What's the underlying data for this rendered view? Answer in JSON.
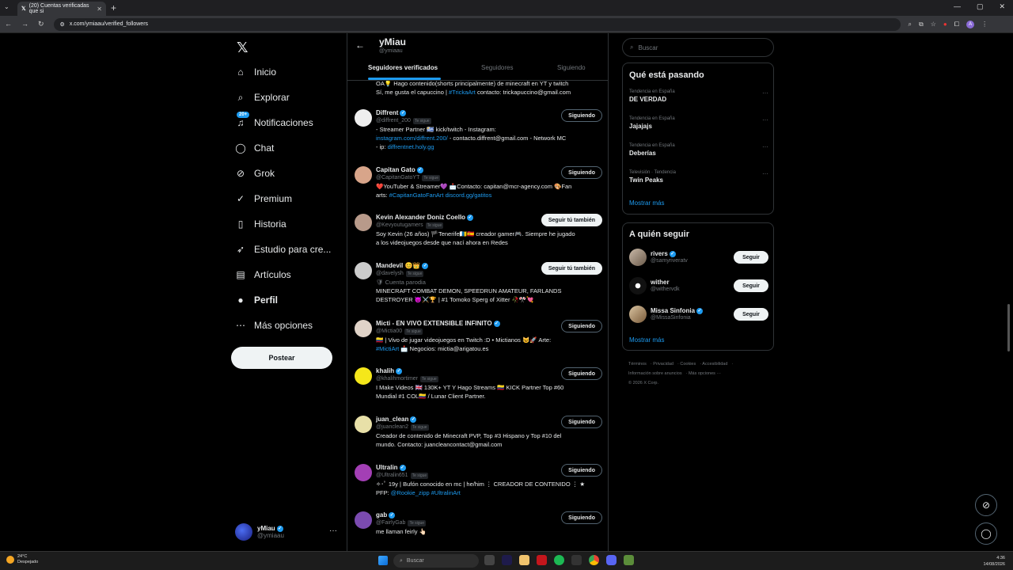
{
  "browser": {
    "tab_title": "(20) Cuentas verificadas que si",
    "url": "x.com/ymiaau/verified_followers"
  },
  "nav": {
    "items": [
      {
        "label": "Inicio",
        "icon": "home-icon"
      },
      {
        "label": "Explorar",
        "icon": "search-icon"
      },
      {
        "label": "Notificaciones",
        "icon": "bell-icon",
        "badge": "20+"
      },
      {
        "label": "Chat",
        "icon": "chat-icon"
      },
      {
        "label": "Grok",
        "icon": "grok-icon"
      },
      {
        "label": "Premium",
        "icon": "premium-icon"
      },
      {
        "label": "Historia",
        "icon": "bookmark-icon"
      },
      {
        "label": "Estudio para cre...",
        "icon": "rocket-icon"
      },
      {
        "label": "Artículos",
        "icon": "article-icon"
      },
      {
        "label": "Perfil",
        "icon": "person-icon"
      },
      {
        "label": "Más opciones",
        "icon": "more-icon"
      }
    ],
    "post_label": "Postear",
    "account": {
      "name": "yMiau",
      "handle": "@ymiaau"
    }
  },
  "profile_header": {
    "name": "yMiau",
    "handle": "@ymiaau",
    "tabs": [
      "Seguidores verificados",
      "Seguidores",
      "Siguiendo"
    ]
  },
  "followers": [
    {
      "name": "",
      "handle": "",
      "button": "",
      "bio_html": "OA💡 Hago contenido(shorts principalmente) de minecraft en YT y twitch<br>Sí, me gusta el capuccino | <span class='link'>#TrickaArt</span> contacto: trickapuccino@gmail.com"
    },
    {
      "name": "Diffrent",
      "handle": "@diffrent_200",
      "button": "Siguiendo",
      "bio_html": "- Streamer Partner 🇺🇾 kick/twitch - Instagram:<br><span class='link'>instagram.com/diffrent.200/</span> - contacto.diffrent@gmail.com - Network MC<br>- ip: <span class='link'>diffrentnet.holy.gg</span>"
    },
    {
      "name": "Capitan Gato",
      "handle": "@CapitanGatoYT",
      "button": "Siguiendo",
      "bio_html": "❤️YouTuber &amp; Streamer💜 📩Contacto: capitan@mcr-agency.com 🎨Fan<br>arts: <span class='link'>#CapitanGatoFanArt</span> <span class='link'>discord.gg/gatitos</span>"
    },
    {
      "name": "Kevin Alexander Doniz Coello",
      "handle": "@Kevyoutugamers",
      "button": "Seguir tú también",
      "bio_html": "Soy Kevin (26 años) 🏴Tenerife🇮🇨🇪🇸 creador gamer🎮. Siempre he jugado<br>a los videojuegos desde que nací ahora en Redes"
    },
    {
      "name": "Mandevil 😊👑",
      "handle": "@davelysh",
      "button": "Seguir tú también",
      "bio_html": "<span style='color:#71767b'>🛡 Cuenta parodia</span><br>MINECRAFT COMBAT DEMON, SPEEDRUN AMATEUR, FARLANDS<br>DESTROYER 😈⚔️🏆 | #1 Tomoko Sperg of Xitter 🥀🎌💘"
    },
    {
      "name": "Micti - EN VIVO EXTENSIBLE INFINITO",
      "handle": "@Mictia00",
      "button": "Siguiendo",
      "bio_html": "🇨🇴 | Vivo de jugar videojuegos en Twitch :D • Micti​anos 😺🚀 Arte:<br><span class='link'>#MictiArt</span> 📩 Negocios: mictia@arigatou.es"
    },
    {
      "name": "khalih",
      "handle": "@khalihmortimer",
      "button": "Siguiendo",
      "bio_html": "I Make Videos 🇬🇧 130K+ YT Y Hago Streams 🇨🇴 KICK Partner Top #60<br>Mundial #1 COL🇨🇴 / Lunar Client Partner."
    },
    {
      "name": "juan_clean",
      "handle": "@juanclean2",
      "button": "Siguiendo",
      "bio_html": "Creador de contenido de Minecraft PVP, Top #3 Hispano y Top #10 del<br>mundo. Contacto: juancleancontact@gmail.com"
    },
    {
      "name": "Ultralin",
      "handle": "@Ultralin651",
      "button": "Siguiendo",
      "bio_html": "✧･ﾟ 19y | Bufón conocido en mc | he/him ⋮ CREADOR DE CONTENIDO ⋮ ★<br>PFP: <span class='link'>@Rookie_zipp</span> <span class='link'>#UltralinArt</span>"
    },
    {
      "name": "gab",
      "handle": "@FairlyGab",
      "button": "Siguiendo",
      "bio_html": "me llaman feirly 👆🏻"
    }
  ],
  "tesigue_label": "Te sigue",
  "sidebar": {
    "search_placeholder": "Buscar",
    "trends_title": "Qué está pasando",
    "trends": [
      {
        "context": "Tendencia en España",
        "title": "DE VERDAD"
      },
      {
        "context": "Tendencia en España",
        "title": "Jajajajs"
      },
      {
        "context": "Tendencia en España",
        "title": "Deberías"
      },
      {
        "context": "Televisión · Tendencia",
        "title": "Twin Peaks"
      }
    ],
    "show_more": "Mostrar más",
    "who_title": "A quién seguir",
    "who": [
      {
        "name": "rivers",
        "handle": "@samyriveratv",
        "button": "Seguir"
      },
      {
        "name": "wither",
        "handle": "@withervdk",
        "button": "Seguir"
      },
      {
        "name": "Missa Sinfonia",
        "handle": "@MissaSinfonia",
        "button": "Seguir"
      }
    ],
    "who_show_more": "Mostrar más",
    "footer": [
      "Términos",
      "Privacidad",
      "Cookies",
      "Accesibilidad",
      "Información sobre anuncios",
      "Más opciones ···",
      "© 2026 X Corp."
    ]
  },
  "taskbar": {
    "temp": "24°C",
    "weather": "Despejado",
    "search": "Buscar",
    "time": "4:36",
    "date": "14/08/2026"
  }
}
